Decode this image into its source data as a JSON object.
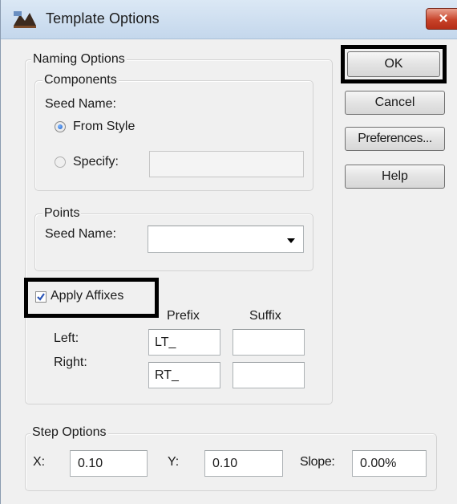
{
  "window": {
    "title": "Template Options",
    "title_icon": "template-icon",
    "close_icon": "close-icon",
    "close_glyph": "✕"
  },
  "naming_options": {
    "label": "Naming Options",
    "components": {
      "label": "Components",
      "seed_name_label": "Seed Name:",
      "from_style_label": "From Style",
      "from_style_selected": true,
      "specify_label": "Specify:",
      "specify_selected": false,
      "specify_value": ""
    },
    "points": {
      "label": "Points",
      "seed_name_label": "Seed Name:",
      "seed_name_value": ""
    },
    "affixes": {
      "apply_label": "Apply Affixes",
      "apply_checked": true,
      "prefix_header": "Prefix",
      "suffix_header": "Suffix",
      "left_label": "Left:",
      "left_prefix": "LT_",
      "left_suffix": "",
      "right_label": "Right:",
      "right_prefix": "RT_",
      "right_suffix": ""
    }
  },
  "buttons": {
    "ok": "OK",
    "cancel": "Cancel",
    "preferences": "Preferences...",
    "help": "Help"
  },
  "step_options": {
    "label": "Step Options",
    "x_label": "X:",
    "x_value": "0.10",
    "y_label": "Y:",
    "y_value": "0.10",
    "slope_label": "Slope:",
    "slope_value": "0.00%"
  },
  "colors": {
    "title_gradient_top": "#dbe8f5",
    "close_red": "#c8432a",
    "highlight": "#000000",
    "check_blue": "#2a55b8"
  }
}
